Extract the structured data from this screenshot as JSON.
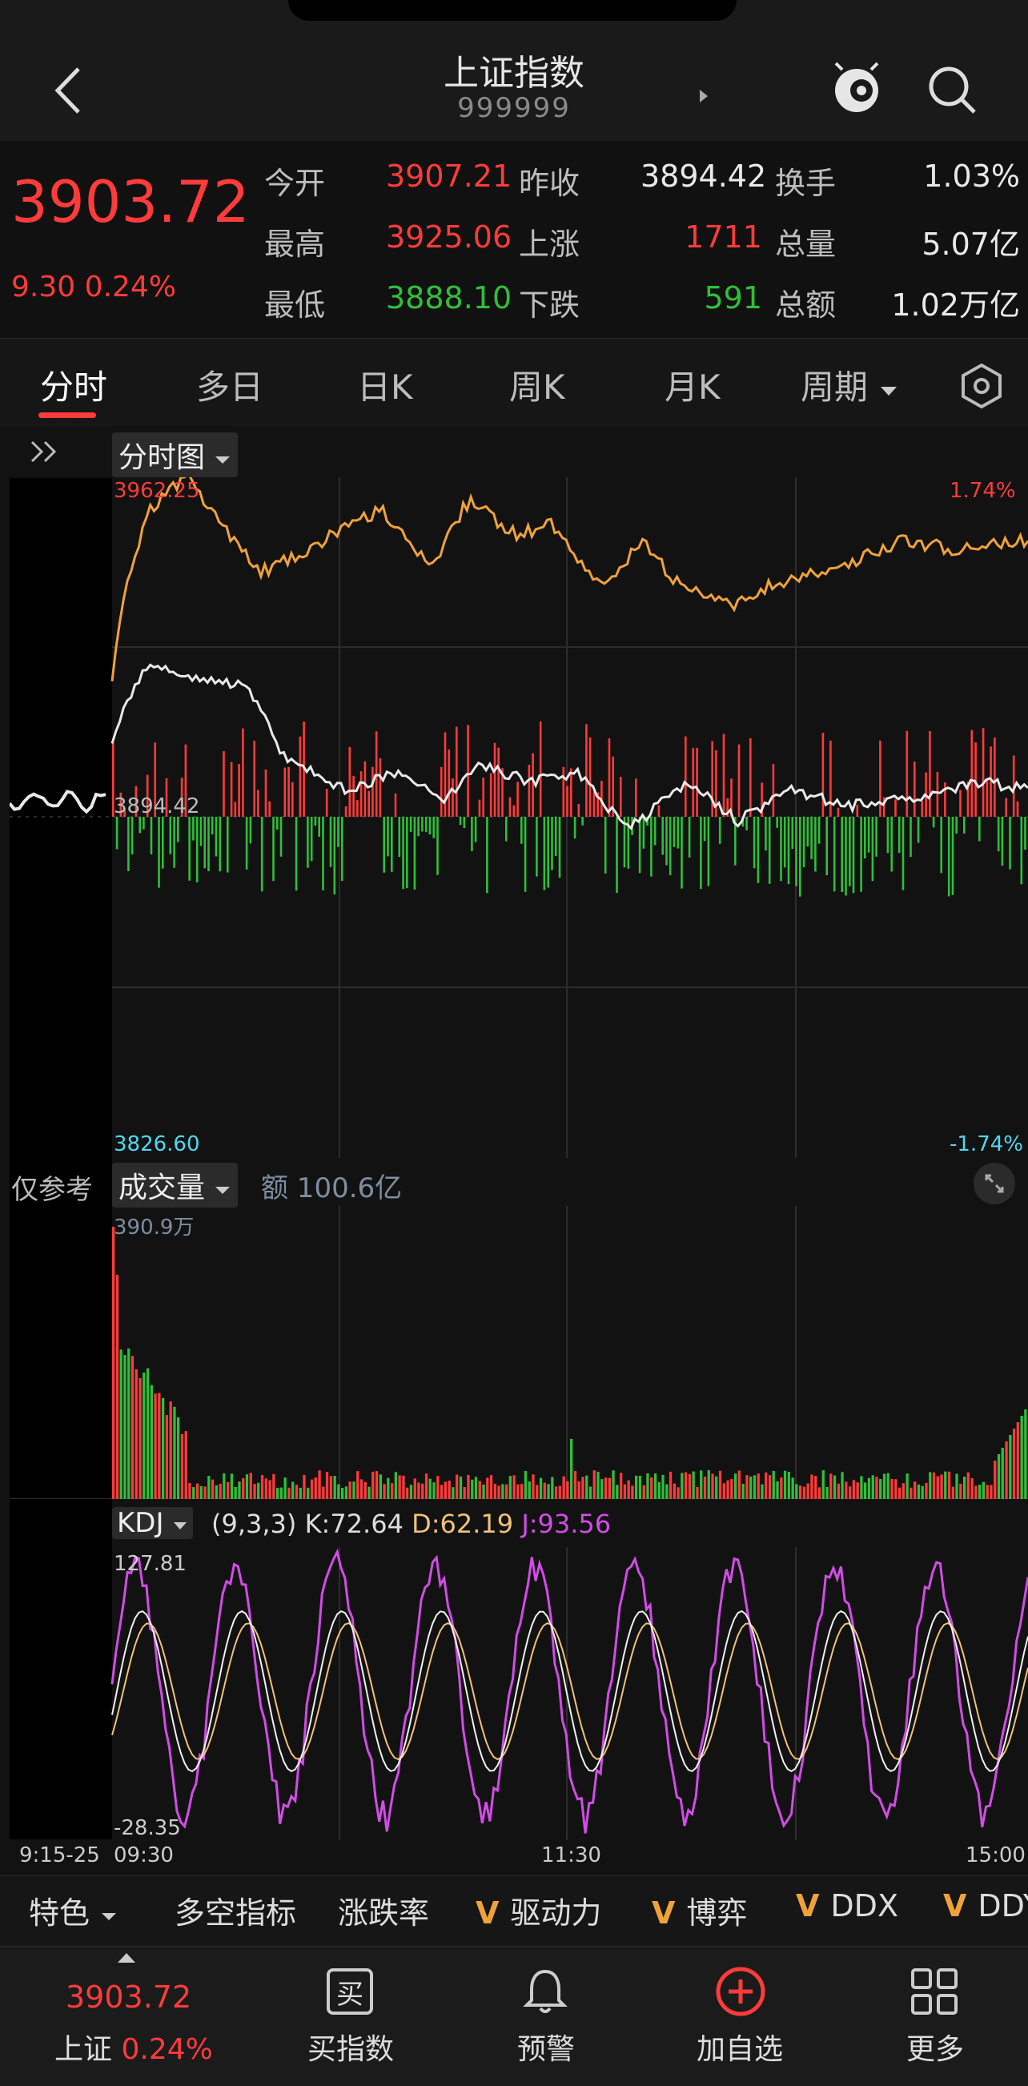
{
  "header": {
    "title": "上证指数",
    "code": "999999"
  },
  "quote": {
    "price": "3903.72",
    "change": "9.30 0.24%",
    "open_label": "今开",
    "open": "3907.21",
    "prev_close_label": "昨收",
    "prev_close": "3894.42",
    "turnover_label": "换手",
    "turnover": "1.03%",
    "high_label": "最高",
    "high": "3925.06",
    "up_label": "上涨",
    "up": "1711",
    "volume_label": "总量",
    "volume": "5.07亿",
    "low_label": "最低",
    "low": "3888.10",
    "down_label": "下跌",
    "down": "591",
    "amount_label": "总额",
    "amount": "1.02万亿"
  },
  "tabs": [
    "分时",
    "多日",
    "日K",
    "周K",
    "月K",
    "周期"
  ],
  "chart": {
    "mode_label": "分时图",
    "top_price": "3962.25",
    "top_pct": "1.74%",
    "mid_price": "3894.42",
    "bottom_price": "3826.60",
    "bottom_pct": "-1.74%",
    "ref_only": "仅参考",
    "volume_label": "成交量",
    "amount_text": "额 100.6亿",
    "volume_max": "390.9万",
    "kdj_label": "KDJ",
    "kdj_params": "(9,3,3)",
    "kdj_k": "K:72.64",
    "kdj_d": "D:62.19",
    "kdj_j": "J:93.56",
    "kdj_top": "127.81",
    "kdj_bottom": "-28.35",
    "time_start_pre": "9:15-25",
    "time_start": "09:30",
    "time_mid": "11:30",
    "time_end": "15:00",
    "colors": {
      "price_line": "#e9e9e9",
      "avg_line": "#f0a23a",
      "up": "#ff3b3b",
      "down": "#2fbf3a",
      "j_line": "#d24ce6",
      "d_line": "#f0c27a"
    }
  },
  "tools": {
    "special": "特色",
    "items": [
      "多空指标",
      "涨跌率",
      "驱动力",
      "博弈",
      "DDX",
      "DDY"
    ],
    "v_mark": "V"
  },
  "bottom_nav": {
    "price": "3903.72",
    "market": "上证",
    "pct": "0.24%",
    "buy": "买指数",
    "alert": "预警",
    "add": "加自选",
    "more": "更多",
    "buy_glyph": "买"
  }
}
